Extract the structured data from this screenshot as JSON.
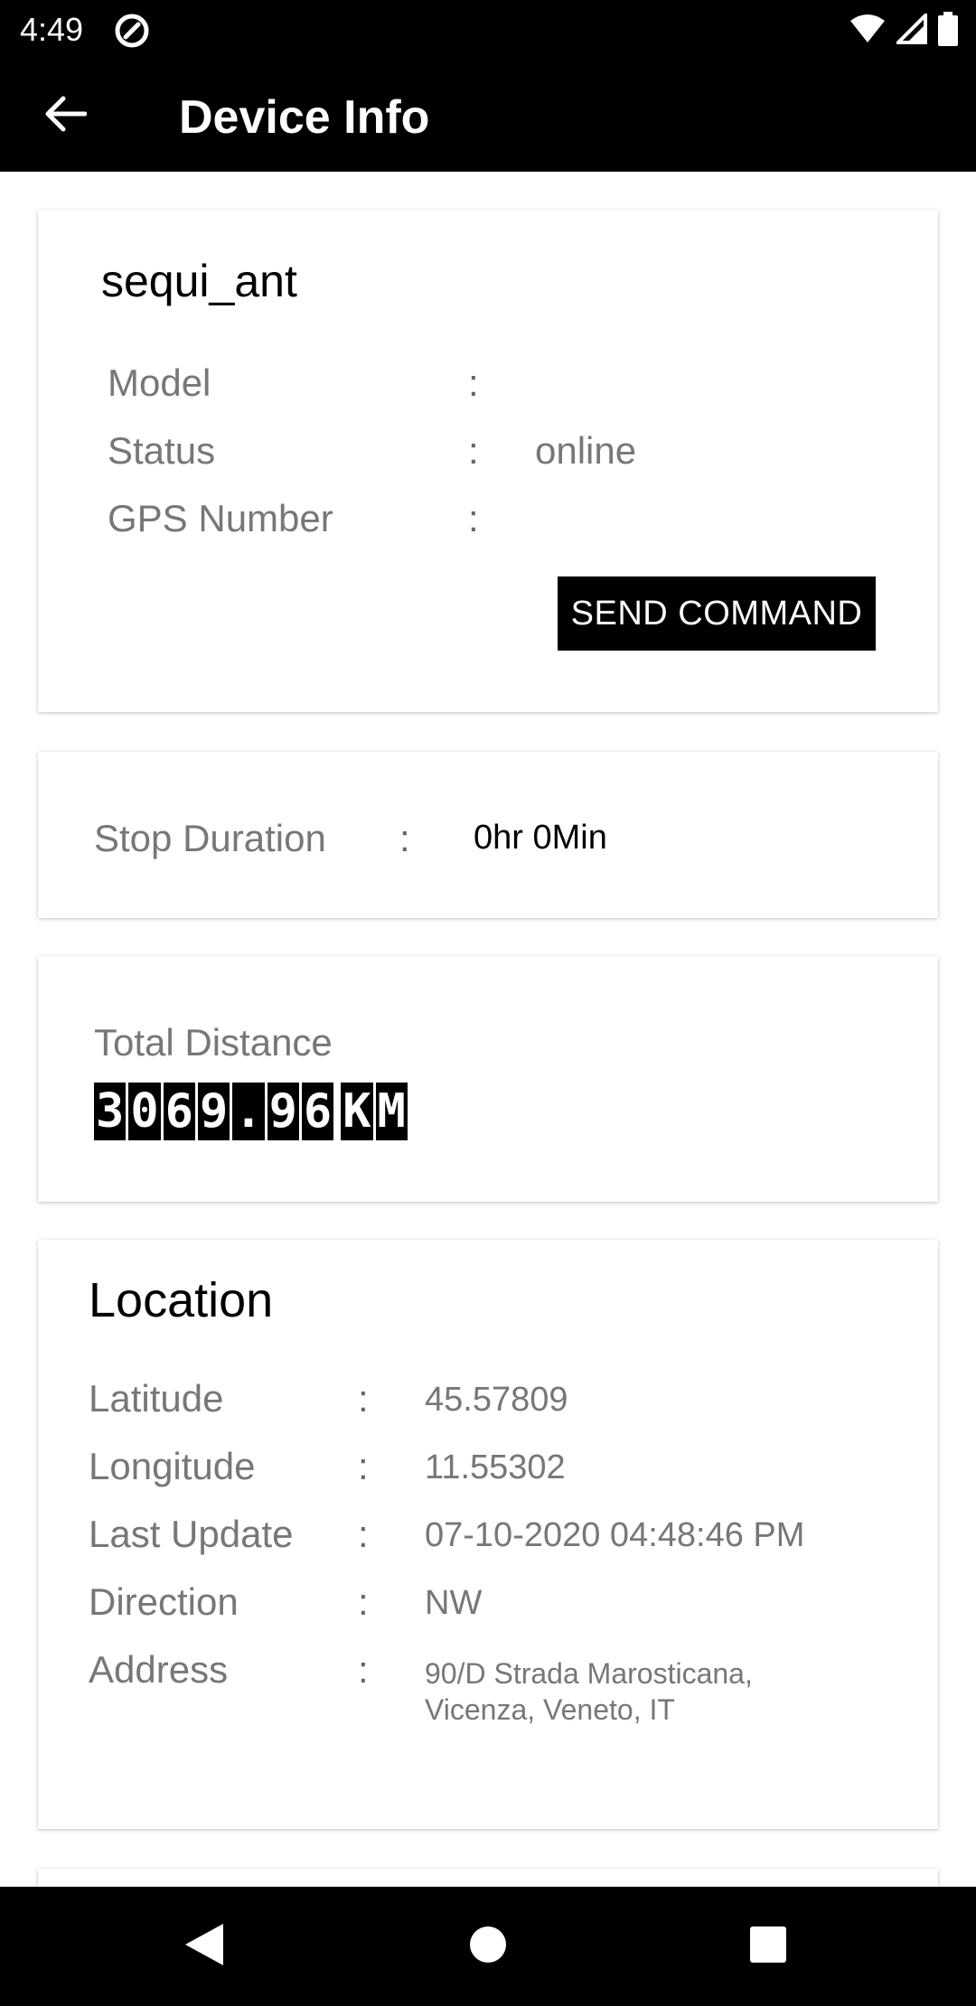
{
  "status_bar": {
    "time": "4:49",
    "app_icon": "at-sign-icon",
    "icons": [
      "wifi-icon",
      "cell-signal-icon",
      "battery-icon"
    ]
  },
  "app_bar": {
    "title": "Device Info",
    "back_icon": "arrow-back-icon"
  },
  "device": {
    "name": "sequi_ant",
    "fields": [
      {
        "label": "Model",
        "colon": ":",
        "value": ""
      },
      {
        "label": "Status",
        "colon": ":",
        "value": "online"
      },
      {
        "label": "GPS Number",
        "colon": ":",
        "value": ""
      }
    ],
    "send_command_label": "SEND COMMAND"
  },
  "stop": {
    "label": "Stop Duration",
    "colon": ":",
    "value": "0hr 0Min"
  },
  "distance": {
    "label": "Total Distance",
    "value_chars": [
      "3",
      "0",
      "6",
      "9",
      ".",
      "9",
      "6"
    ],
    "unit_chars": [
      "K",
      "M"
    ]
  },
  "location": {
    "title": "Location",
    "fields": [
      {
        "label": "Latitude",
        "colon": ":",
        "value": "45.57809"
      },
      {
        "label": "Longitude",
        "colon": ":",
        "value": "11.55302"
      },
      {
        "label": "Last Update",
        "colon": ":",
        "value": "07-10-2020 04:48:46 PM"
      },
      {
        "label": "Direction",
        "colon": ":",
        "value": "NW"
      }
    ],
    "address": {
      "label": "Address",
      "colon": ":",
      "line1": "90/D Strada Marosticana,",
      "line2": "Vicenza, Veneto, IT"
    }
  },
  "nav_bar": {
    "back": "nav-back-icon",
    "home": "nav-home-icon",
    "recents": "nav-recents-icon"
  },
  "colors": {
    "bar_background": "#000000",
    "label_gray": "#777777",
    "card_background": "#ffffff"
  }
}
